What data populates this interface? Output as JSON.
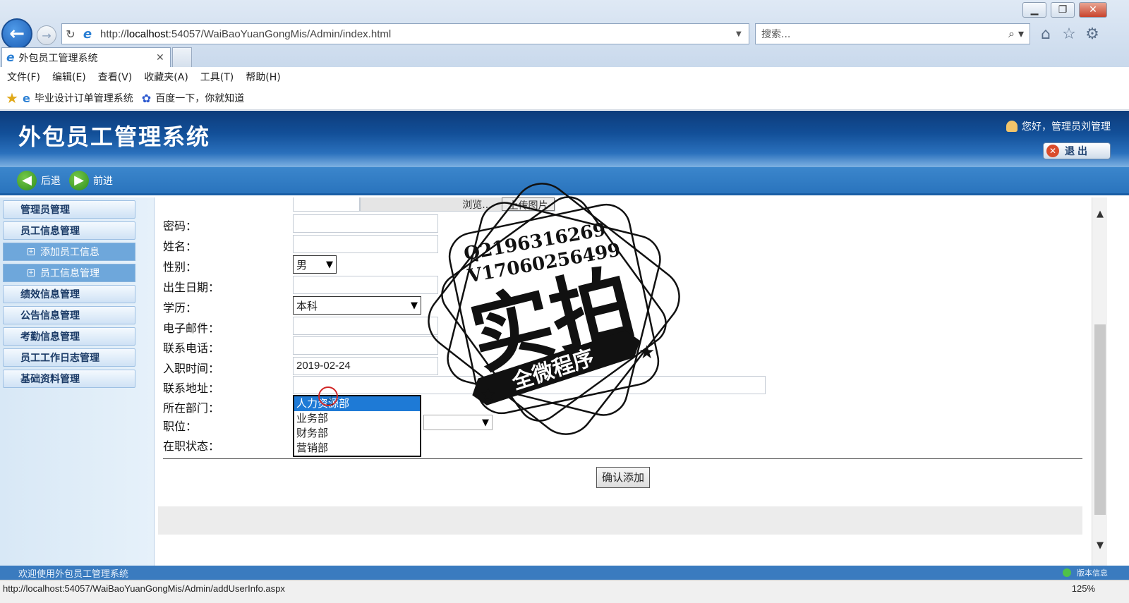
{
  "browser": {
    "url_prefix": "http://",
    "url_host": "localhost",
    "url_rest": ":54057/WaiBaoYuanGongMis/Admin/index.html",
    "search_placeholder": "搜索...",
    "tab_title": "外包员工管理系统",
    "tab_close": "✕",
    "menu": [
      "文件(F)",
      "编辑(E)",
      "查看(V)",
      "收藏夹(A)",
      "工具(T)",
      "帮助(H)"
    ],
    "favorites": [
      "毕业设计订单管理系统",
      "百度一下，你就知道"
    ],
    "status_url": "http://localhost:54057/WaiBaoYuanGongMis/Admin/addUserInfo.aspx",
    "zoom": "125%",
    "win_min": "▁",
    "win_max": "❐",
    "win_close": "✕"
  },
  "icons": {
    "back": "back-arrow-icon",
    "forward": "forward-arrow-icon",
    "refresh": "refresh-icon",
    "home": "home-icon",
    "favorites": "star-icon",
    "settings": "gear-icon",
    "search": "search-icon"
  },
  "header": {
    "title": "外包员工管理系统",
    "greeting": "您好，管理员刘管理",
    "logout_label": "退出"
  },
  "nav": {
    "back_label": "后退",
    "forward_label": "前进"
  },
  "sidebar": {
    "items": [
      {
        "label": "管理员管理"
      },
      {
        "label": "员工信息管理"
      },
      {
        "label": "添加员工信息"
      },
      {
        "label": "员工信息管理"
      },
      {
        "label": "绩效信息管理"
      },
      {
        "label": "公告信息管理"
      },
      {
        "label": "考勤信息管理"
      },
      {
        "label": "员工工作日志管理"
      },
      {
        "label": "基础资料管理"
      }
    ]
  },
  "form": {
    "upload_browse": "浏览...",
    "upload_button": "上传图片",
    "labels": {
      "password": "密码：",
      "name": "姓名：",
      "gender": "性别：",
      "birth": "出生日期：",
      "education": "学历：",
      "email": "电子邮件：",
      "phone": "联系电话：",
      "hire_date": "入职时间：",
      "address": "联系地址：",
      "department": "所在部门：",
      "position": "职位：",
      "status": "在职状态："
    },
    "values": {
      "gender": "男",
      "education": "本科",
      "hire_date": "2019-02-24"
    },
    "department_options": [
      "人力资源部",
      "业务部",
      "财务部",
      "营销部"
    ],
    "submit_label": "确认添加"
  },
  "footer": {
    "welcome": "欢迎使用外包员工管理系统",
    "version": "版本信息"
  },
  "watermark": {
    "line1": "Q2196316269",
    "line2": "V17060256499",
    "main": "实拍",
    "banner": "全微程序"
  }
}
